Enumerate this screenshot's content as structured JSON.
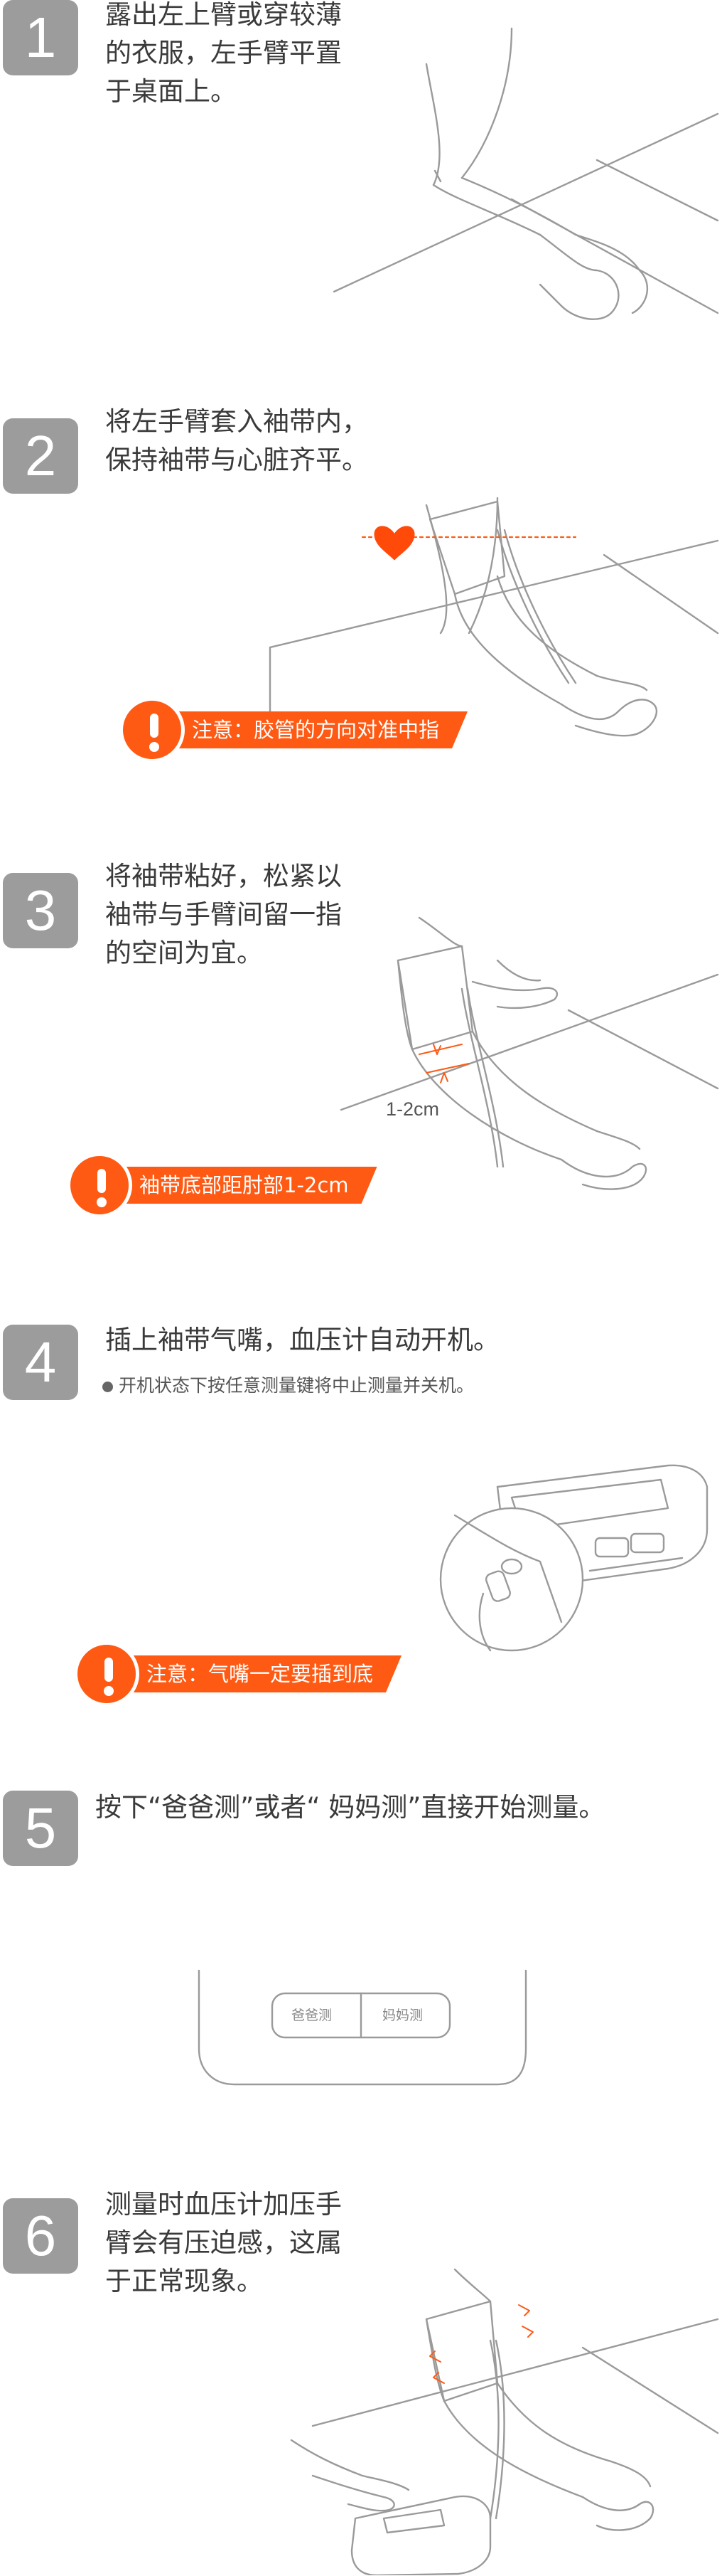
{
  "steps": [
    {
      "num": "1",
      "lines": [
        "露出左上臂或穿较薄",
        "的衣服，左手臂平置",
        "于桌面上。"
      ]
    },
    {
      "num": "2",
      "lines": [
        "将左手臂套入袖带内，",
        "保持袖带与心脏齐平。"
      ],
      "warning": "注意：胶管的方向对准中指"
    },
    {
      "num": "3",
      "lines": [
        "将袖带粘好，松紧以",
        "袖带与手臂间留一指",
        "的空间为宜。"
      ],
      "warning": "袖带底部距肘部1-2cm",
      "measure_label": "1-2cm"
    },
    {
      "num": "4",
      "lines": [
        "插上袖带气嘴，血压计自动开机。"
      ],
      "note": "开机状态下按任意测量键将中止测量并关机。",
      "warning": "注意：气嘴一定要插到底"
    },
    {
      "num": "5",
      "lines": [
        "按下“爸爸测”或者“ 妈妈测”直接开始测量。"
      ],
      "buttons": [
        "爸爸测",
        "妈妈测"
      ]
    },
    {
      "num": "6",
      "lines": [
        "测量时血压计加压手",
        "臂会有压迫感，这属",
        "于正常现象。"
      ]
    }
  ],
  "colors": {
    "accent": "#ff5a14",
    "step_badge": "#9c9c9c",
    "heart": "#ff4a0a",
    "line_art": "#9a9a9a"
  }
}
